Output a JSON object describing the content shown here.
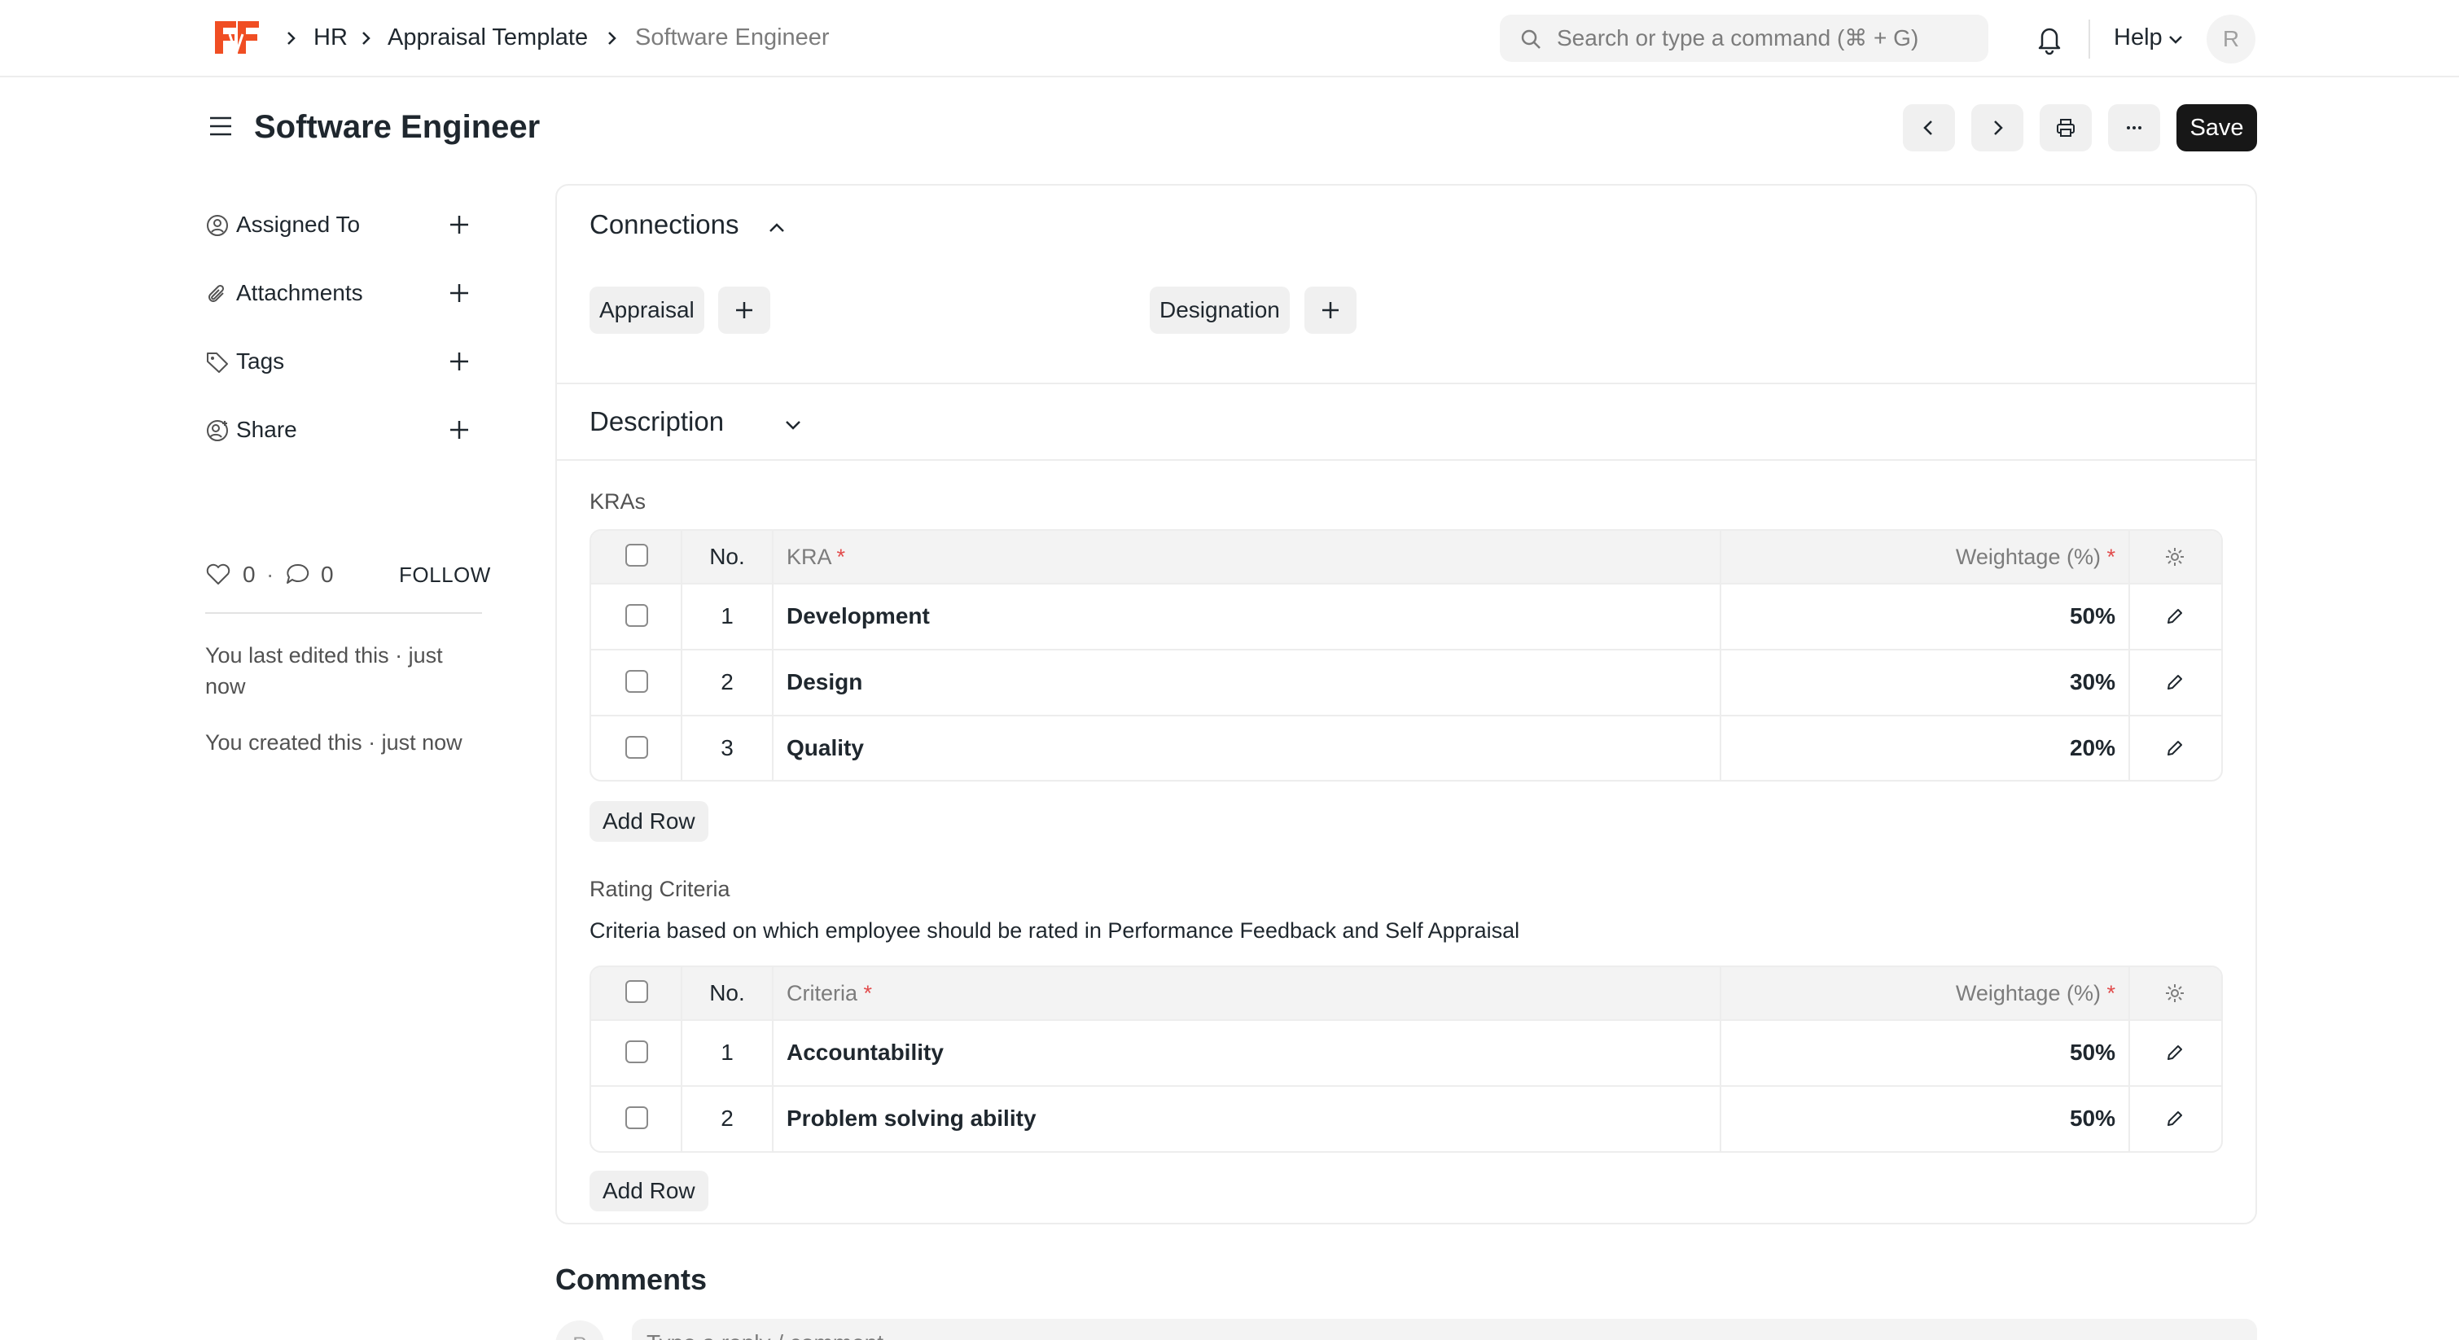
{
  "navbar": {
    "breadcrumbs": [
      "HR",
      "Appraisal Template",
      "Software Engineer"
    ],
    "search_placeholder": "Search or type a command (⌘ + G)",
    "help_label": "Help",
    "avatar_initial": "R"
  },
  "header": {
    "title": "Software Engineer",
    "save_label": "Save"
  },
  "sidebar": {
    "items": [
      {
        "label": "Assigned To",
        "icon": "assign-icon"
      },
      {
        "label": "Attachments",
        "icon": "paperclip-icon"
      },
      {
        "label": "Tags",
        "icon": "tag-icon"
      },
      {
        "label": "Share",
        "icon": "share-icon"
      }
    ],
    "likes": "0",
    "comments": "0",
    "dot": "·",
    "follow_label": "FOLLOW",
    "last_edited": "You last edited this · just now",
    "created": "You created this · just now"
  },
  "connections": {
    "title": "Connections",
    "links": [
      "Appraisal",
      "Designation"
    ]
  },
  "description": {
    "title": "Description"
  },
  "kras": {
    "label": "KRAs",
    "columns": {
      "no": "No.",
      "main": "KRA",
      "weight": "Weightage (%)",
      "required_mark": "*"
    },
    "rows": [
      {
        "no": "1",
        "name": "Development",
        "weight": "50%"
      },
      {
        "no": "2",
        "name": "Design",
        "weight": "30%"
      },
      {
        "no": "3",
        "name": "Quality",
        "weight": "20%"
      }
    ],
    "add_row_label": "Add Row"
  },
  "rating_criteria": {
    "label": "Rating Criteria",
    "description": "Criteria based on which employee should be rated in Performance Feedback and Self Appraisal",
    "columns": {
      "no": "No.",
      "main": "Criteria",
      "weight": "Weightage (%)",
      "required_mark": "*"
    },
    "rows": [
      {
        "no": "1",
        "name": "Accountability",
        "weight": "50%"
      },
      {
        "no": "2",
        "name": "Problem solving ability",
        "weight": "50%"
      }
    ],
    "add_row_label": "Add Row"
  },
  "comments": {
    "title": "Comments",
    "avatar_initial": "R",
    "placeholder": "Type a reply / comment"
  },
  "colors": {
    "brand": "#f04e23",
    "primary_button": "#171717",
    "required": "#e24c4c"
  }
}
